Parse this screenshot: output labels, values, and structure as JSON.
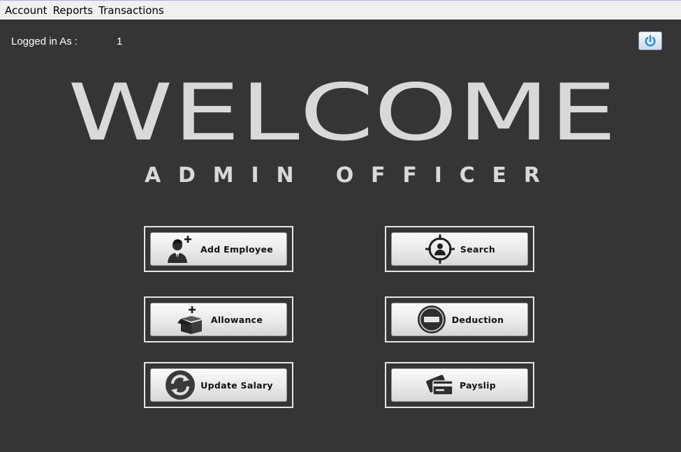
{
  "menu": {
    "items": [
      {
        "label": "Account"
      },
      {
        "label": "Reports"
      },
      {
        "label": "Transactions"
      }
    ]
  },
  "session": {
    "logged_in_label": "Logged in As :",
    "logged_in_value": "1"
  },
  "header": {
    "welcome_text": "WELCOME",
    "subtitle_text": "ADMIN OFFICER"
  },
  "buttons": {
    "add_employee": {
      "label": "Add Employee",
      "icon": "add-user-icon"
    },
    "search": {
      "label": "Search",
      "icon": "target-icon"
    },
    "allowance": {
      "label": "Allowance",
      "icon": "add-box-icon"
    },
    "deduction": {
      "label": "Deduction",
      "icon": "minus-circle-icon"
    },
    "update_salary": {
      "label": "Update Salary",
      "icon": "refresh-icon"
    },
    "payslip": {
      "label": "Payslip",
      "icon": "cards-icon"
    }
  },
  "colors": {
    "background": "#353535",
    "title_text": "#d9d9d9",
    "power_icon": "#2a8fd8"
  }
}
